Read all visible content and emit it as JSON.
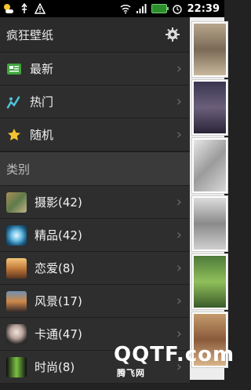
{
  "status": {
    "time": "22:39"
  },
  "drawer": {
    "title": "疯狂壁纸",
    "nav": [
      {
        "label": "最新",
        "icon": "news-icon"
      },
      {
        "label": "热门",
        "icon": "trend-icon"
      },
      {
        "label": "随机",
        "icon": "star-icon"
      }
    ],
    "section_label": "类别",
    "categories": [
      {
        "label": "摄影(42)"
      },
      {
        "label": "精品(42)"
      },
      {
        "label": "恋爱(8)"
      },
      {
        "label": "风景(17)"
      },
      {
        "label": "卡通(47)"
      },
      {
        "label": "时尚(8)"
      }
    ]
  },
  "watermark": {
    "main": "QQTF.com",
    "side": "腾飞网"
  }
}
